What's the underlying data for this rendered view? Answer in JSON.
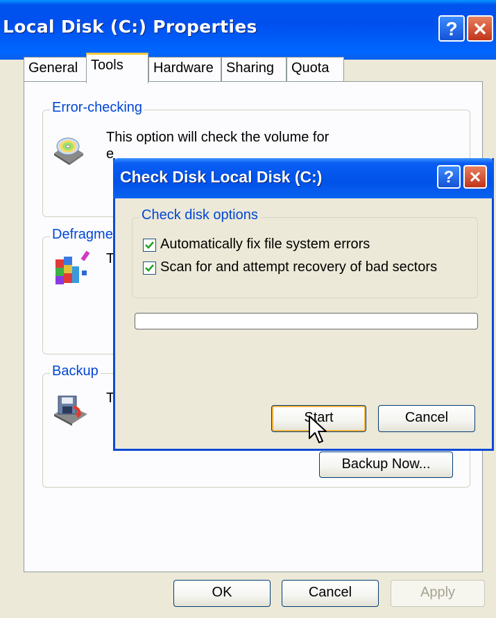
{
  "window": {
    "title": "Local Disk (C:) Properties",
    "help_button": "?",
    "close_button": "✕"
  },
  "tabs": [
    {
      "label": "General",
      "active": false
    },
    {
      "label": "Tools",
      "active": true
    },
    {
      "label": "Hardware",
      "active": false
    },
    {
      "label": "Sharing",
      "active": false
    },
    {
      "label": "Quota",
      "active": false
    }
  ],
  "tools": {
    "error_checking": {
      "title": "Error-checking",
      "text_line1": "This option will check the volume for",
      "text_line2": "e",
      "icon": "disk-check-icon"
    },
    "defrag": {
      "title": "Defragme",
      "text": "T",
      "icon": "defrag-icon"
    },
    "backup": {
      "title": "Backup",
      "text": "T",
      "icon": "backup-icon",
      "button": "Backup Now..."
    }
  },
  "footer": {
    "ok": "OK",
    "cancel": "Cancel",
    "apply": "Apply"
  },
  "dialog": {
    "title": "Check Disk Local Disk (C:)",
    "help_button": "?",
    "close_button": "✕",
    "options_group": "Check disk options",
    "options": [
      {
        "label": "Automatically fix file system errors",
        "checked": true
      },
      {
        "label": "Scan for and attempt recovery of bad sectors",
        "checked": true
      }
    ],
    "progress": 0,
    "start_button": "Start",
    "cancel_button": "Cancel"
  },
  "colors": {
    "titlebar": "#0054e3",
    "group_label": "#0046d5",
    "active_tab_accent": "#ffc83c",
    "checkmark": "#21a121"
  }
}
